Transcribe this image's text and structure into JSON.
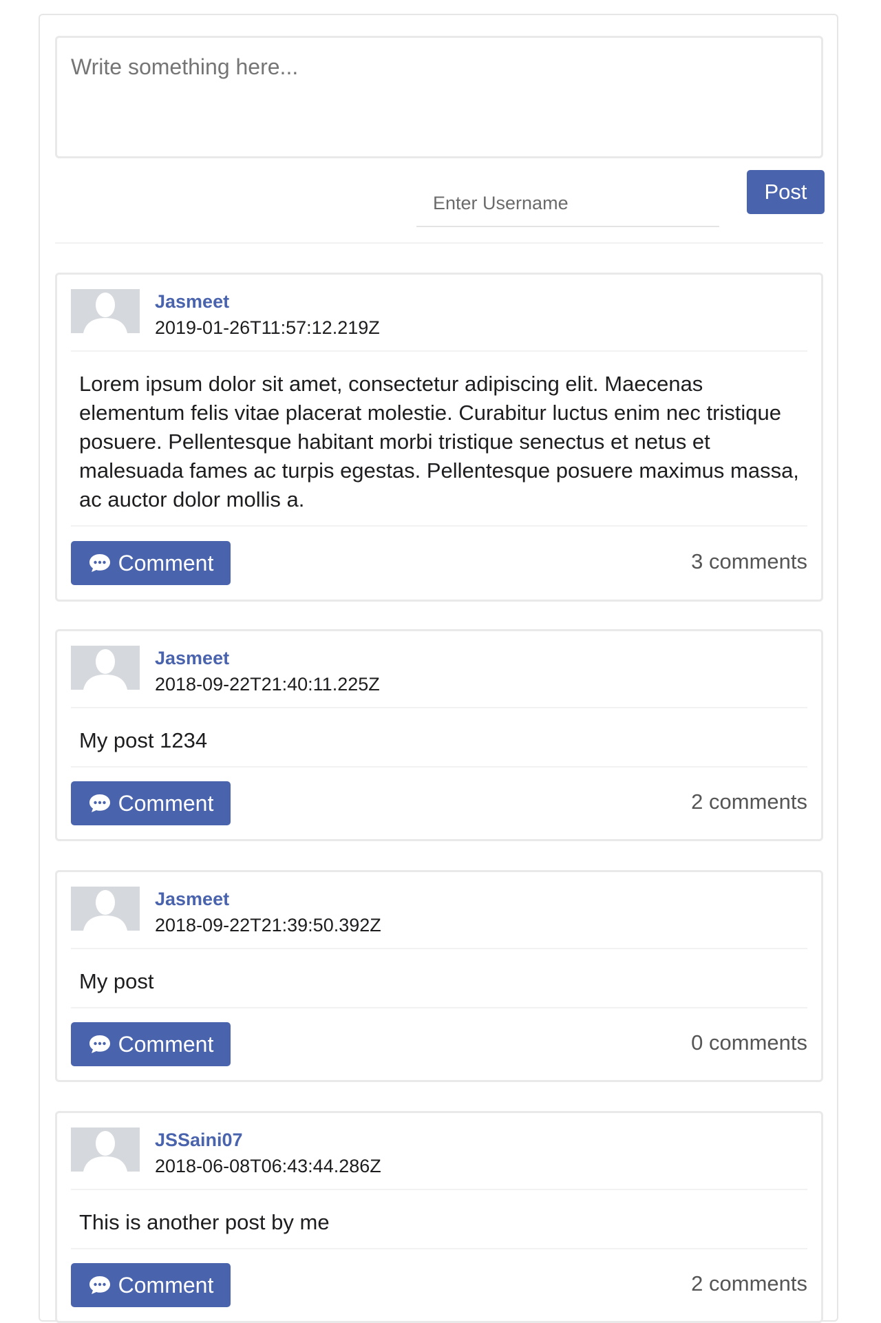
{
  "composer": {
    "placeholder": "Write something here...",
    "username_placeholder": "Enter Username",
    "post_label": "Post"
  },
  "theme": {
    "accent": "#4a63ad",
    "avatar_bg": "#d5d8dc",
    "border": "#e9e9e9"
  },
  "posts": [
    {
      "username": "Jasmeet",
      "timestamp": "2019-01-26T11:57:12.219Z",
      "body": "Lorem ipsum dolor sit amet, consectetur adipiscing elit. Maecenas elementum felis vitae placerat molestie. Curabitur luctus enim nec tristique posuere. Pellentesque habitant morbi tristique senectus et netus et malesuada fames ac turpis egestas. Pellentesque posuere maximus massa, ac auctor dolor mollis a.",
      "comment_label": "Comment",
      "comments_count": "3 comments"
    },
    {
      "username": "Jasmeet",
      "timestamp": "2018-09-22T21:40:11.225Z",
      "body": "My post 1234",
      "comment_label": "Comment",
      "comments_count": "2 comments"
    },
    {
      "username": "Jasmeet",
      "timestamp": "2018-09-22T21:39:50.392Z",
      "body": "My post",
      "comment_label": "Comment",
      "comments_count": "0 comments"
    },
    {
      "username": "JSSaini07",
      "timestamp": "2018-06-08T06:43:44.286Z",
      "body": "This is another post by me",
      "comment_label": "Comment",
      "comments_count": "2 comments"
    }
  ]
}
